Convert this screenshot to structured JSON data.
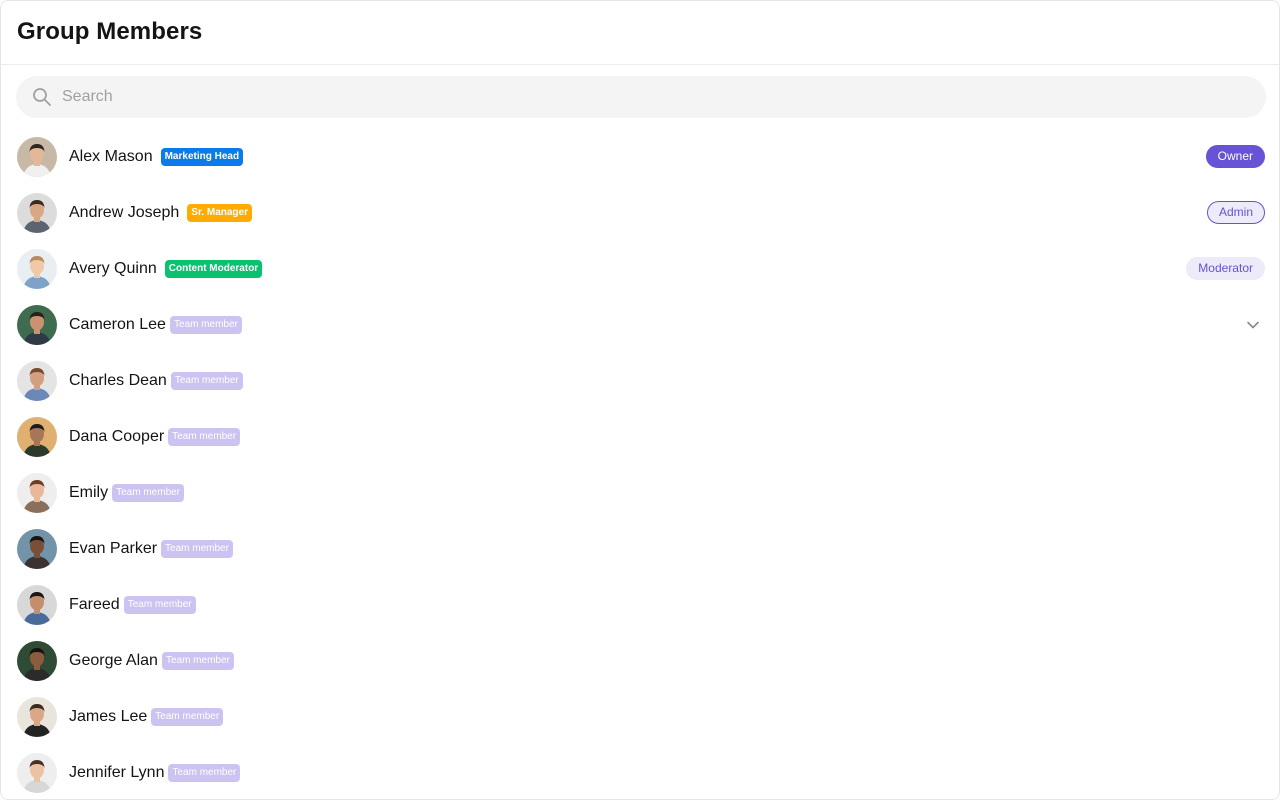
{
  "header": {
    "title": "Group Members"
  },
  "search": {
    "placeholder": "Search",
    "value": ""
  },
  "members": [
    {
      "name": "Alex Mason",
      "tag": "Marketing Head",
      "tag_color": "#0b7bea",
      "role": "Owner",
      "avatar_bg": "#c8b8a6",
      "skin": "#e2b899",
      "hair": "#2f2420",
      "shirt": "#f0f0f0"
    },
    {
      "name": "Andrew Joseph",
      "tag": "Sr. Manager",
      "tag_color": "#ffab00",
      "role": "Admin",
      "avatar_bg": "#dcdcdc",
      "skin": "#d9a784",
      "hair": "#3a2a20",
      "shirt": "#5b6470"
    },
    {
      "name": "Avery Quinn",
      "tag": "Content Moderator",
      "tag_color": "#09c26f",
      "role": "Moderator",
      "avatar_bg": "#e9eef3",
      "skin": "#f1c9a9",
      "hair": "#b98a5e",
      "shirt": "#7fa3c7"
    },
    {
      "name": "Cameron Lee",
      "tag": "Team member",
      "tag_color": "#cdc3f2",
      "role_icon": "chevron-down-icon",
      "avatar_bg": "#3f6b4e",
      "skin": "#c99373",
      "hair": "#2a211c",
      "shirt": "#2e3a46"
    },
    {
      "name": "Charles Dean",
      "tag": "Team member",
      "tag_color": "#cdc3f2",
      "avatar_bg": "#e4e4e4",
      "skin": "#d2a07e",
      "hair": "#7a4a2c",
      "shirt": "#6b88b6"
    },
    {
      "name": "Dana Cooper",
      "tag": "Team member",
      "tag_color": "#cdc3f2",
      "avatar_bg": "#e0b070",
      "skin": "#a77657",
      "hair": "#1b1b1b",
      "shirt": "#2b3a2b"
    },
    {
      "name": "Emily",
      "tag": "Team member",
      "tag_color": "#cdc3f2",
      "avatar_bg": "#eeeeee",
      "skin": "#e8b898",
      "hair": "#6a3f25",
      "shirt": "#8a6f5a"
    },
    {
      "name": "Evan Parker",
      "tag": "Team member",
      "tag_color": "#cdc3f2",
      "avatar_bg": "#7393a8",
      "skin": "#7a4f38",
      "hair": "#1a1412",
      "shirt": "#3b3330"
    },
    {
      "name": "Fareed",
      "tag": "Team member",
      "tag_color": "#cdc3f2",
      "avatar_bg": "#d8d8d8",
      "skin": "#c38e6b",
      "hair": "#1d1612",
      "shirt": "#4a6a9a"
    },
    {
      "name": "George Alan",
      "tag": "Team member",
      "tag_color": "#cdc3f2",
      "avatar_bg": "#2f4a35",
      "skin": "#8c5c40",
      "hair": "#161210",
      "shirt": "#2b2b2b"
    },
    {
      "name": "James Lee",
      "tag": "Team member",
      "tag_color": "#cdc3f2",
      "avatar_bg": "#e9e4dc",
      "skin": "#dba887",
      "hair": "#3a2a20",
      "shirt": "#232323"
    },
    {
      "name": "Jennifer Lynn",
      "tag": "Team member",
      "tag_color": "#cdc3f2",
      "avatar_bg": "#eeeeee",
      "skin": "#ecc2a4",
      "hair": "#4a2e22",
      "shirt": "#d7d7d7"
    }
  ],
  "colors": {
    "accent": "#6852d6",
    "accent_light": "#edeafa",
    "tag_lavender": "#cdc3f2"
  }
}
